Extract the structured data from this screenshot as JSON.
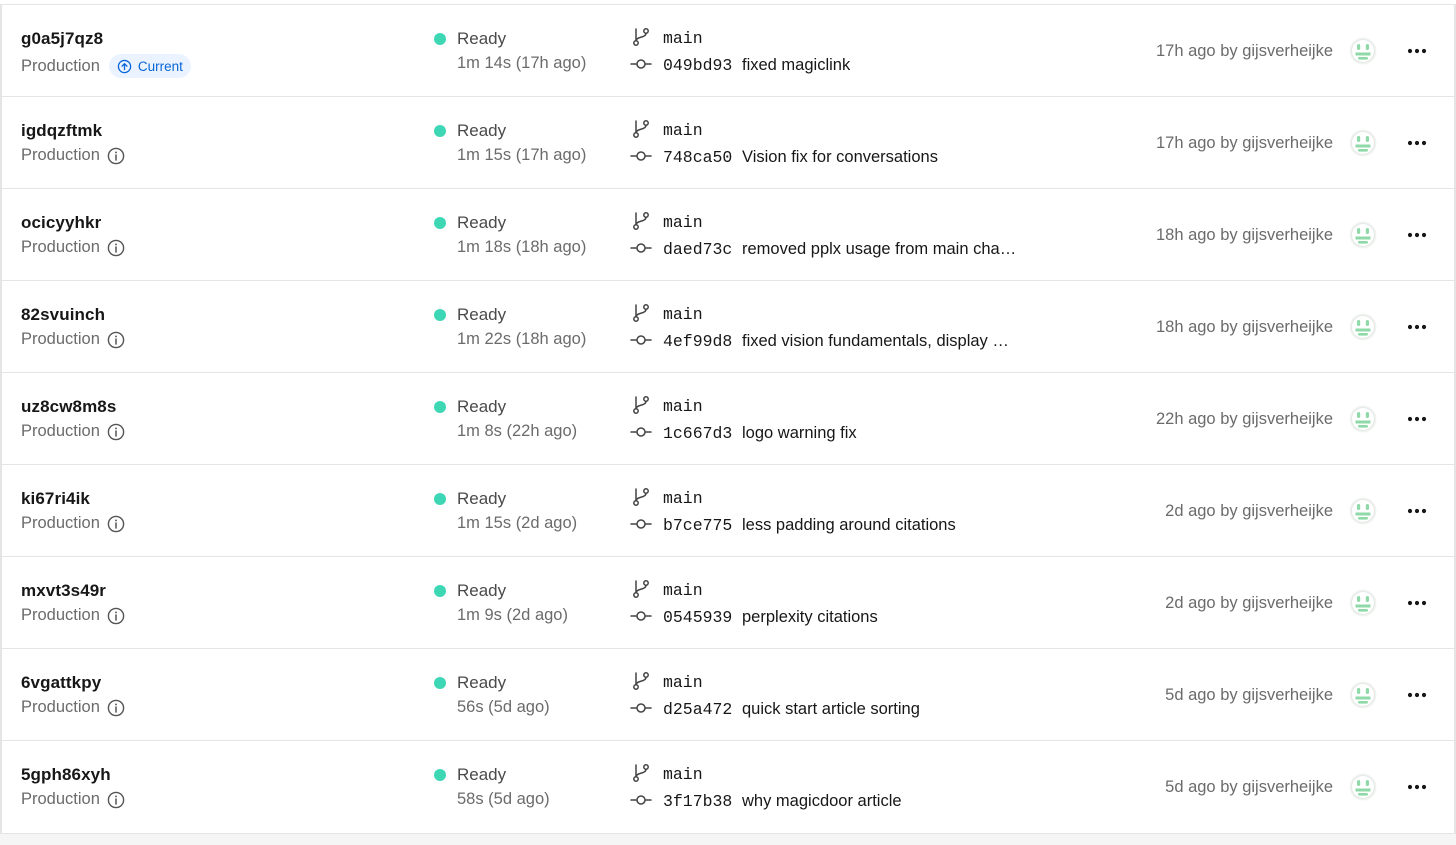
{
  "colors": {
    "ready": "#3ed7b6",
    "accent": "#0a66d8",
    "avatar": "#8fd9a8"
  },
  "icons": {
    "info": "info-circle-icon",
    "current": "arrow-up-circle-icon",
    "branch": "git-branch-icon",
    "commit": "git-commit-icon",
    "more": "ellipsis-icon",
    "avatar": "avatar-face-icon"
  },
  "deployments": [
    {
      "id": "g0a5j7qz8",
      "environment": "Production",
      "current_label": "Current",
      "status": "Ready",
      "duration": "1m 14s (17h ago)",
      "branch": "main",
      "commit_hash": "049bd93",
      "commit_message": "fixed magiclink",
      "meta": "17h ago by gijsverheijke"
    },
    {
      "id": "igdqzftmk",
      "environment": "Production",
      "status": "Ready",
      "duration": "1m 15s (17h ago)",
      "branch": "main",
      "commit_hash": "748ca50",
      "commit_message": "Vision fix for conversations",
      "meta": "17h ago by gijsverheijke"
    },
    {
      "id": "ocicyyhkr",
      "environment": "Production",
      "status": "Ready",
      "duration": "1m 18s (18h ago)",
      "branch": "main",
      "commit_hash": "daed73c",
      "commit_message": "removed pplx usage from main cha…",
      "meta": "18h ago by gijsverheijke"
    },
    {
      "id": "82svuinch",
      "environment": "Production",
      "status": "Ready",
      "duration": "1m 22s (18h ago)",
      "branch": "main",
      "commit_hash": "4ef99d8",
      "commit_message": "fixed vision fundamentals, display …",
      "meta": "18h ago by gijsverheijke"
    },
    {
      "id": "uz8cw8m8s",
      "environment": "Production",
      "status": "Ready",
      "duration": "1m 8s (22h ago)",
      "branch": "main",
      "commit_hash": "1c667d3",
      "commit_message": "logo warning fix",
      "meta": "22h ago by gijsverheijke"
    },
    {
      "id": "ki67ri4ik",
      "environment": "Production",
      "status": "Ready",
      "duration": "1m 15s (2d ago)",
      "branch": "main",
      "commit_hash": "b7ce775",
      "commit_message": "less padding around citations",
      "meta": "2d ago by gijsverheijke"
    },
    {
      "id": "mxvt3s49r",
      "environment": "Production",
      "status": "Ready",
      "duration": "1m 9s (2d ago)",
      "branch": "main",
      "commit_hash": "0545939",
      "commit_message": "perplexity citations",
      "meta": "2d ago by gijsverheijke"
    },
    {
      "id": "6vgattkpy",
      "environment": "Production",
      "status": "Ready",
      "duration": "56s (5d ago)",
      "branch": "main",
      "commit_hash": "d25a472",
      "commit_message": "quick start article sorting",
      "meta": "5d ago by gijsverheijke"
    },
    {
      "id": "5gph86xyh",
      "environment": "Production",
      "status": "Ready",
      "duration": "58s (5d ago)",
      "branch": "main",
      "commit_hash": "3f17b38",
      "commit_message": "why magicdoor article",
      "meta": "5d ago by gijsverheijke"
    }
  ]
}
